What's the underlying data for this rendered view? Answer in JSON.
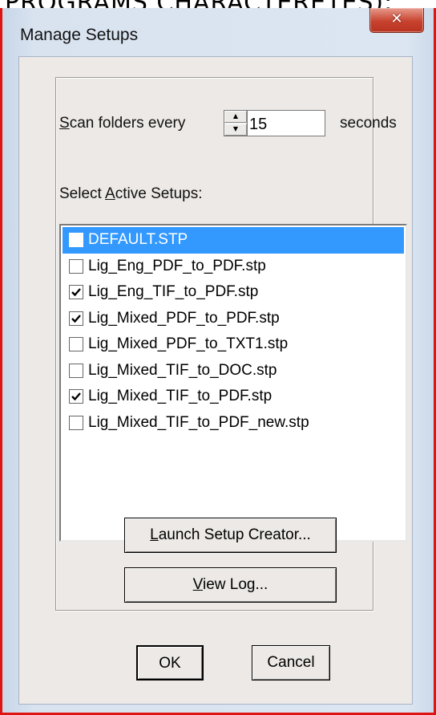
{
  "background_heading": "PROGRAMS CHARACTERETES):",
  "window": {
    "title": "Manage Setups",
    "close_glyph": "✕"
  },
  "scan": {
    "label_prefix_u": "S",
    "label_rest": "can folders every",
    "value": "15",
    "unit": "seconds"
  },
  "setups": {
    "label_prefix": "Select ",
    "label_u": "A",
    "label_rest": "ctive Setups:",
    "items": [
      {
        "name": "DEFAULT.STP",
        "checked": false,
        "selected": true
      },
      {
        "name": "Lig_Eng_PDF_to_PDF.stp",
        "checked": false,
        "selected": false
      },
      {
        "name": "Lig_Eng_TIF_to_PDF.stp",
        "checked": true,
        "selected": false
      },
      {
        "name": "Lig_Mixed_PDF_to_PDF.stp",
        "checked": true,
        "selected": false
      },
      {
        "name": "Lig_Mixed_PDF_to_TXT1.stp",
        "checked": false,
        "selected": false
      },
      {
        "name": "Lig_Mixed_TIF_to_DOC.stp",
        "checked": false,
        "selected": false
      },
      {
        "name": "Lig_Mixed_TIF_to_PDF.stp",
        "checked": true,
        "selected": false
      },
      {
        "name": "Lig_Mixed_TIF_to_PDF_new.stp",
        "checked": false,
        "selected": false
      }
    ]
  },
  "buttons": {
    "launch_u": "L",
    "launch_rest": "aunch Setup Creator...",
    "log_u": "V",
    "log_rest": "iew Log...",
    "ok": "OK",
    "cancel": "Cancel"
  },
  "colors": {
    "selection": "#3399ff",
    "frame_border": "#e01313"
  }
}
